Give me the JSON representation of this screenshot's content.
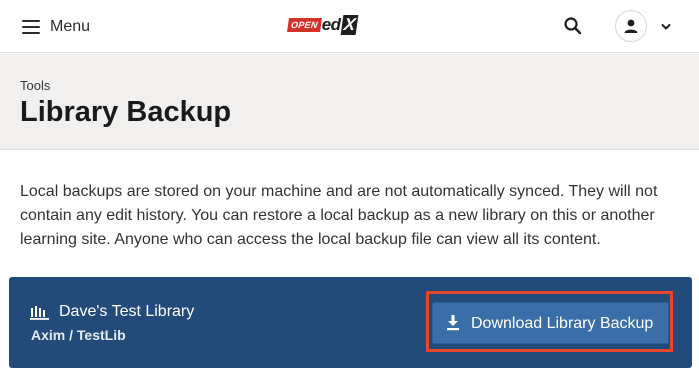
{
  "topbar": {
    "menu_label": "Menu",
    "logo_open": "OPEN",
    "logo_ed": "ed",
    "logo_x": "X"
  },
  "header": {
    "breadcrumb": "Tools",
    "title": "Library Backup"
  },
  "description": "Local backups are stored on your machine and are not automatically synced. They will not contain any edit history. You can restore a local backup as a new library on this or another learning site. Anyone who can access the local backup file can view all its content.",
  "library": {
    "name": "Dave's Test Library",
    "path": "Axim / TestLib"
  },
  "download_button": {
    "label": "Download Library Backup"
  },
  "icons": {
    "menu": "hamburger-icon",
    "search": "search-icon",
    "user": "user-icon",
    "dropdown": "chevron-down-icon",
    "library": "library-icon",
    "download": "download-icon"
  },
  "colors": {
    "card_background": "#224b7a",
    "button_background": "#3a6ea8",
    "highlight": "#e8452c",
    "logo_red": "#d23228",
    "header_background": "#f2f0ef"
  }
}
